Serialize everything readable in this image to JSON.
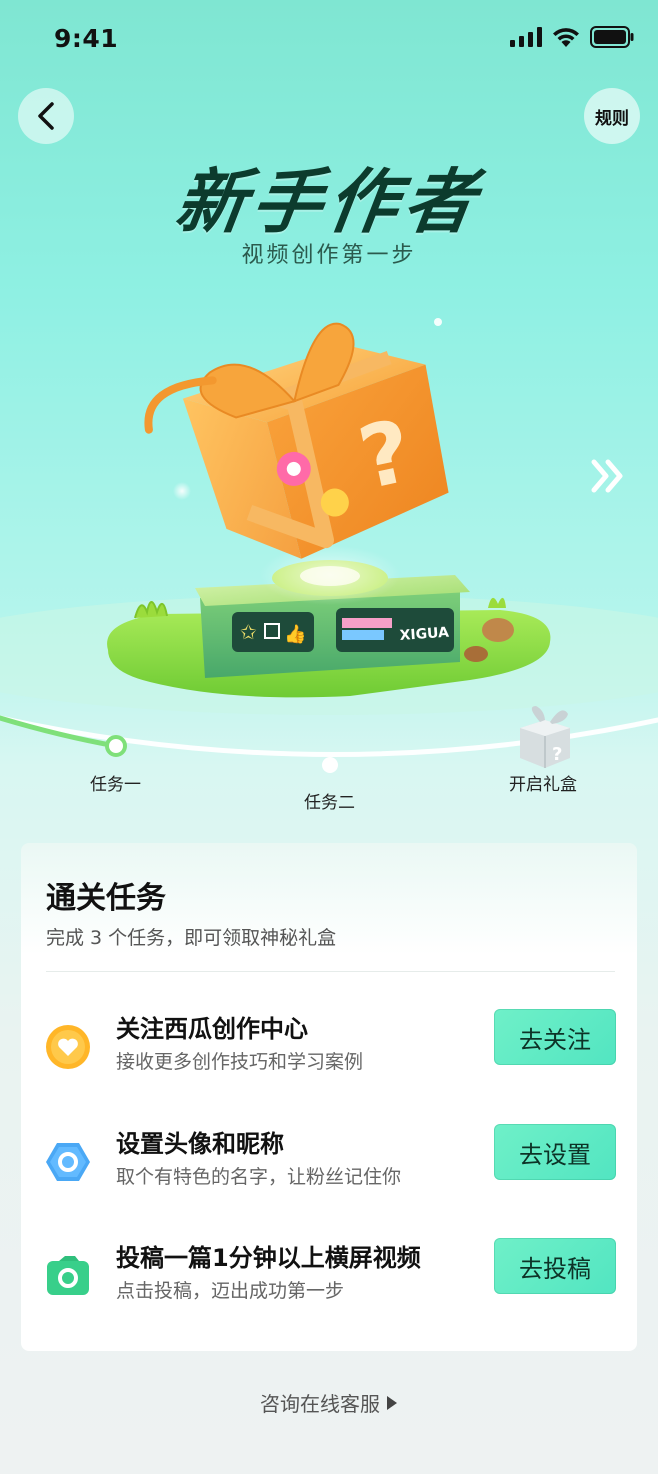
{
  "status_bar": {
    "time": "9:41"
  },
  "header": {
    "rules_label": "规则"
  },
  "hero": {
    "title": "新手作者",
    "subtitle": "视频创作第一步",
    "box_brand": "XIGUA"
  },
  "progress": {
    "steps": [
      {
        "label": "任务一",
        "active": true
      },
      {
        "label": "任务二",
        "active": false
      },
      {
        "label": "开启礼盒",
        "active": false
      }
    ]
  },
  "task_card": {
    "title": "通关任务",
    "subtitle": "完成 3 个任务，即可领取神秘礼盒",
    "tasks": [
      {
        "name": "关注西瓜创作中心",
        "desc": "接收更多创作技巧和学习案例",
        "button": "去关注",
        "icon": "heart-icon",
        "color": "#ffb628"
      },
      {
        "name": "设置头像和昵称",
        "desc": "取个有特色的名字，让粉丝记住你",
        "button": "去设置",
        "icon": "hexagon-icon",
        "color": "#4aa8f5"
      },
      {
        "name": "投稿一篇1分钟以上横屏视频",
        "desc": "点击投稿，迈出成功第一步",
        "button": "去投稿",
        "icon": "camera-icon",
        "color": "#38cf8a"
      }
    ]
  },
  "footer": {
    "support_label": "咨询在线客服"
  },
  "colors": {
    "accent": "#52e5c1",
    "title": "#0c3b2d",
    "gift": "#f4a23a"
  }
}
